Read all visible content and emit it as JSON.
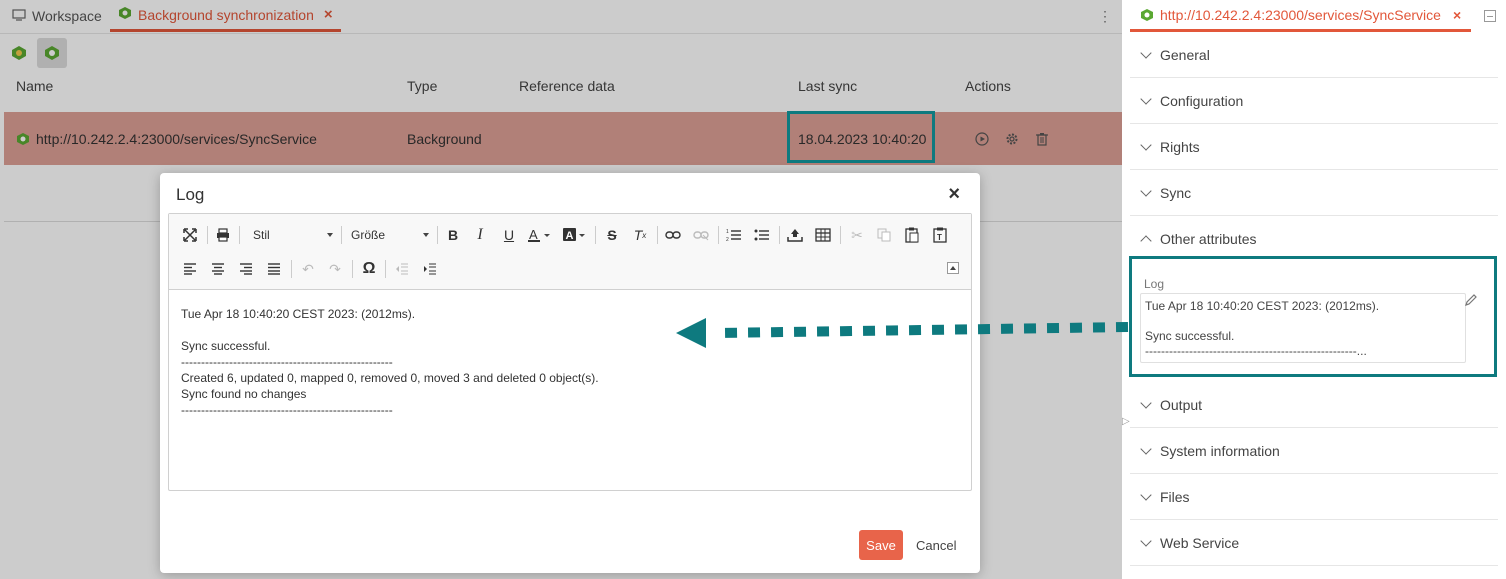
{
  "tabs": {
    "workspace": "Workspace",
    "bgsync": "Background synchronization",
    "close": "×"
  },
  "grid": {
    "columns": [
      "Name",
      "Type",
      "Reference data",
      "Last sync",
      "Actions"
    ],
    "row": {
      "name": "http://10.242.2.4:23000/services/SyncService",
      "type": "Background",
      "last_sync": "18.04.2023 10:40:20"
    }
  },
  "right_panel": {
    "tab": "http://10.242.2.4:23000/services/SyncService",
    "sections_top": [
      "General",
      "Configuration",
      "Rights",
      "Sync",
      "Other attributes"
    ],
    "log_label": "Log",
    "log_preview": [
      "Tue Apr 18 10:40:20 CEST 2023: (2012ms).",
      "Sync successful.",
      "-----------------------------------------------------..."
    ],
    "sections_bottom": [
      "Output",
      "System information",
      "Files",
      "Web Service"
    ]
  },
  "dialog": {
    "title": "Log",
    "close": "×",
    "style_combo": "Stil",
    "size_combo": "Größe",
    "content": [
      "Tue Apr 18 10:40:20 CEST 2023: (2012ms).",
      "",
      "Sync successful.",
      "-----------------------------------------------------",
      "Created 6, updated 0, mapped 0, removed 0, moved 3 and deleted 0 object(s).",
      "Sync found no changes",
      "-----------------------------------------------------"
    ],
    "save": "Save",
    "cancel": "Cancel"
  },
  "colors": {
    "accent": "#e2573a",
    "highlight": "#0e7a7f",
    "row_selected": "#dea096"
  }
}
